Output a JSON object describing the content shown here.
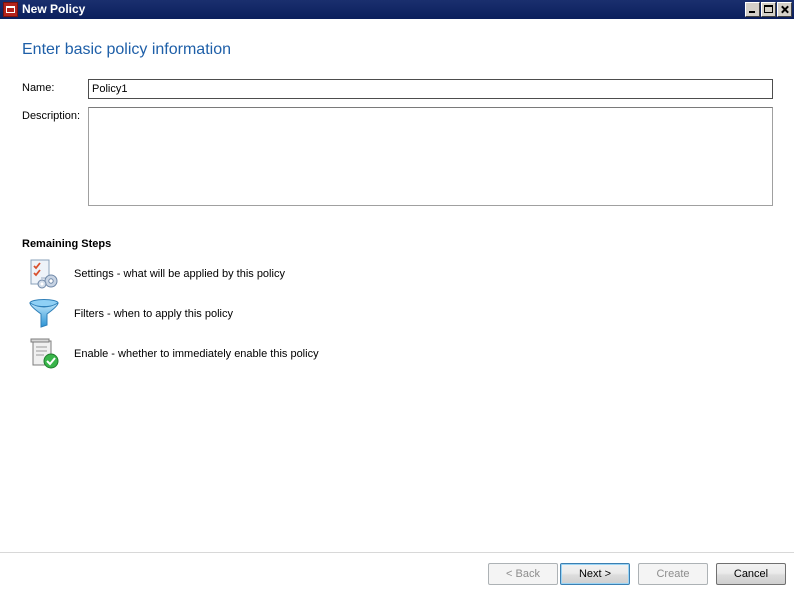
{
  "window": {
    "title": "New Policy",
    "controls": [
      "minimize-icon",
      "maximize-icon",
      "close-icon"
    ]
  },
  "page": {
    "heading": "Enter basic policy information",
    "name_label": "Name:",
    "name_value": "Policy1",
    "description_label": "Description:",
    "description_value": ""
  },
  "remaining_steps": {
    "title": "Remaining Steps",
    "items": [
      {
        "icon": "settings-checklist-icon",
        "label": "Settings - what will be applied by this policy"
      },
      {
        "icon": "funnel-filter-icon",
        "label": "Filters - when to apply this policy"
      },
      {
        "icon": "enable-checkmark-icon",
        "label": "Enable - whether to immediately enable this policy"
      }
    ]
  },
  "buttons": {
    "back": "< Back",
    "next": "Next >",
    "create": "Create",
    "cancel": "Cancel"
  },
  "colors": {
    "titlebar": "#0b1f5c",
    "heading": "#1e5fa8",
    "disabled_text": "#8d8d8d"
  }
}
